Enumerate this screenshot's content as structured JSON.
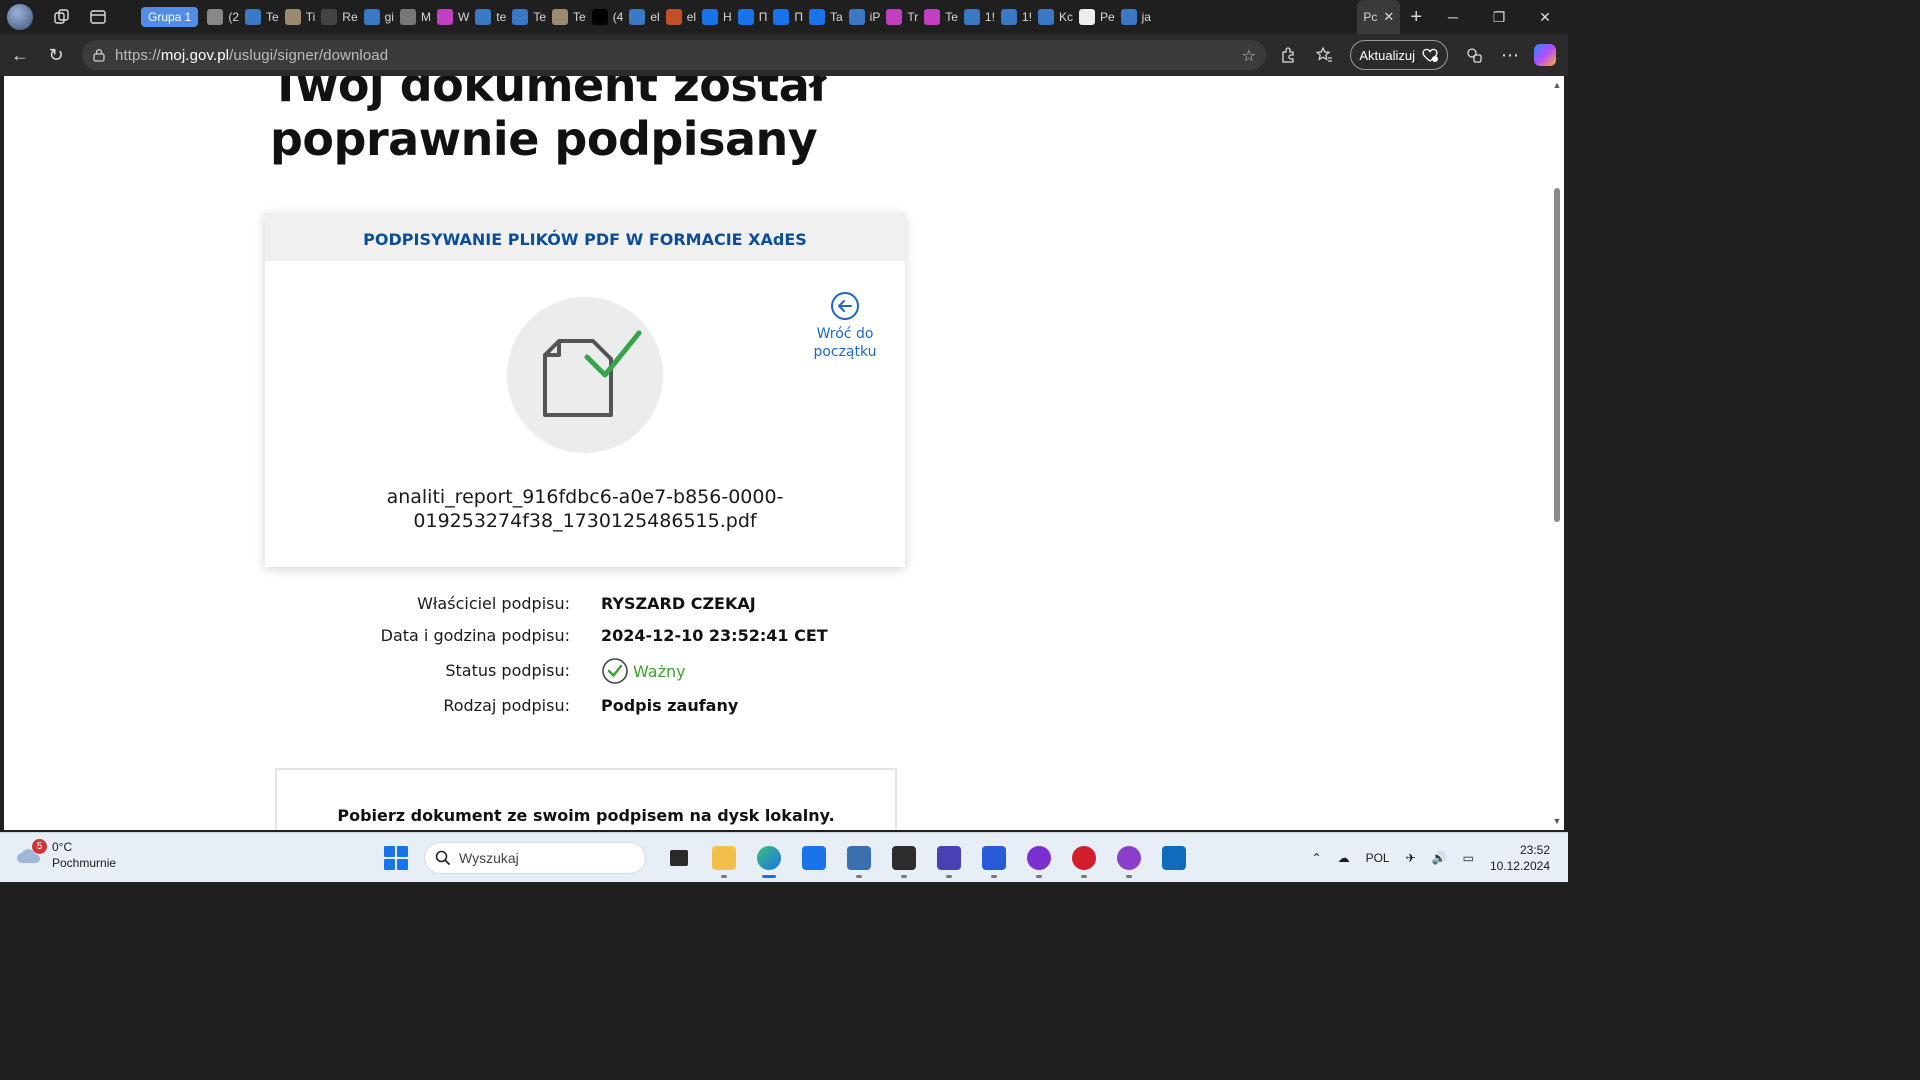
{
  "browser": {
    "group_label": "Grupa 1",
    "tabs": [
      {
        "label": "(2",
        "color": "#888888"
      },
      {
        "label": "Te",
        "color": "#3b78c4"
      },
      {
        "label": "Ti",
        "color": "#9a8a70"
      },
      {
        "label": "Re",
        "color": "#444444"
      },
      {
        "label": "gi",
        "color": "#3b78c4"
      },
      {
        "label": "M",
        "color": "#777777"
      },
      {
        "label": "W",
        "color": "#c040c0"
      },
      {
        "label": "te",
        "color": "#3b78c4"
      },
      {
        "label": "Te",
        "color": "#3b78c4"
      },
      {
        "label": "Te",
        "color": "#9a8a70"
      },
      {
        "label": "(4",
        "color": "#000000"
      },
      {
        "label": "el",
        "color": "#3b78c4"
      },
      {
        "label": "el",
        "color": "#c0502a"
      },
      {
        "label": "H",
        "color": "#1a73e8"
      },
      {
        "label": "П",
        "color": "#1a73e8"
      },
      {
        "label": "П",
        "color": "#1a73e8"
      },
      {
        "label": "Ta",
        "color": "#1a73e8"
      },
      {
        "label": "iP",
        "color": "#3b78c4"
      },
      {
        "label": "Tr",
        "color": "#c040c0"
      },
      {
        "label": "Te",
        "color": "#c040c0"
      },
      {
        "label": "1!",
        "color": "#3b78c4"
      },
      {
        "label": "1!",
        "color": "#3b78c4"
      },
      {
        "label": "Kc",
        "color": "#3b78c4"
      },
      {
        "label": "Pe",
        "color": "#eeeeee"
      },
      {
        "label": "ja",
        "color": "#3b78c4"
      }
    ],
    "active_tab_label": "Pc",
    "url_prefix": "https://",
    "url_host": "moj.gov.pl",
    "url_path": "/uslugi/signer/download",
    "update_button": "Aktualizuj"
  },
  "page": {
    "title_line1": "Twój dokument został",
    "title_line2": "poprawnie podpisany",
    "card_header": "PODPISYWANIE PLIKÓW PDF W FORMACIE XAdES",
    "back_link_line1": "Wróć do",
    "back_link_line2": "początku",
    "filename_line1": "analiti_report_916fdbc6-a0e7-b856-0000-",
    "filename_line2": "019253274f38_1730125486515.pdf",
    "info": {
      "owner_label": "Właściciel podpisu:",
      "owner_value": "RYSZARD CZEKAJ",
      "datetime_label": "Data i godzina podpisu:",
      "datetime_value": "2024-12-10 23:52:41 CET",
      "status_label": "Status podpisu:",
      "status_value": "Ważny",
      "type_label": "Rodzaj podpisu:",
      "type_value": "Podpis zaufany"
    },
    "download_text": "Pobierz dokument ze swoim podpisem na dysk lokalny.",
    "colors": {
      "link_blue": "#1b6ac9",
      "header_blue": "#0a4e9b",
      "valid_green": "#3ea035"
    }
  },
  "taskbar": {
    "weather_temp": "0°C",
    "weather_desc": "Pochmurnie",
    "weather_badge": "5",
    "search_placeholder": "Wyszukaj",
    "language": "POL",
    "time": "23:52",
    "date": "10.12.2024"
  }
}
